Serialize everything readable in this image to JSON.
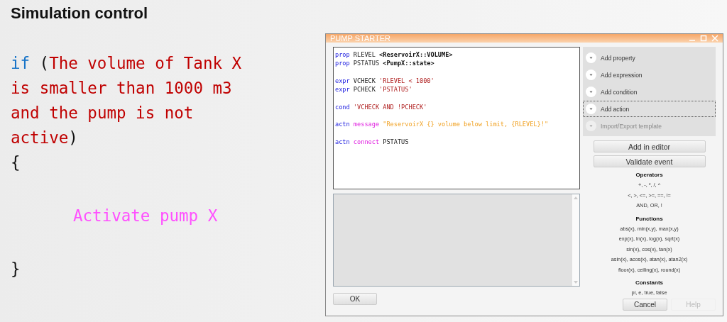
{
  "slide": {
    "title": "Simulation control",
    "code": [
      {
        "gap_before": false,
        "indent": false,
        "tokens": [
          {
            "kind": "keyword",
            "text": "if",
            "attached": true
          },
          {
            "kind": "plain",
            "text": "(",
            "attached": false
          },
          {
            "kind": "condition",
            "text": "The volume of Tank X",
            "attached": true
          }
        ]
      },
      {
        "gap_before": false,
        "indent": false,
        "tokens": [
          {
            "kind": "condition",
            "text": "is smaller than 1000 m3",
            "attached": true
          }
        ]
      },
      {
        "gap_before": false,
        "indent": false,
        "tokens": [
          {
            "kind": "condition",
            "text": "and the pump is not",
            "attached": true
          }
        ]
      },
      {
        "gap_before": false,
        "indent": false,
        "tokens": [
          {
            "kind": "condition",
            "text": "active",
            "attached": true
          },
          {
            "kind": "plain",
            "text": ")",
            "attached": true
          }
        ]
      },
      {
        "gap_before": false,
        "indent": false,
        "tokens": [
          {
            "kind": "plain",
            "text": "{",
            "attached": true
          }
        ]
      },
      {
        "gap_before": true,
        "indent": true,
        "tokens": [
          {
            "kind": "action",
            "text": "Activate pump X",
            "attached": true
          }
        ]
      },
      {
        "gap_before": true,
        "indent": false,
        "tokens": [
          {
            "kind": "plain",
            "text": "}",
            "attached": true
          }
        ]
      }
    ]
  },
  "window": {
    "title": "PUMP STARTER",
    "editor": {
      "lines": [
        {
          "gap_before": false,
          "tokens": [
            {
              "kind": "keyword",
              "text": "prop"
            },
            {
              "kind": "plain",
              "text": "RLEVEL"
            },
            {
              "kind": "type",
              "text": "<ReservoirX::VOLUME>"
            }
          ]
        },
        {
          "gap_before": false,
          "tokens": [
            {
              "kind": "keyword",
              "text": "prop"
            },
            {
              "kind": "plain",
              "text": "PSTATUS"
            },
            {
              "kind": "type",
              "text": "<PumpX::state>"
            }
          ]
        },
        {
          "gap_before": true,
          "tokens": [
            {
              "kind": "keyword",
              "text": "expr"
            },
            {
              "kind": "plain",
              "text": "VCHECK"
            },
            {
              "kind": "string",
              "text": "'RLEVEL < 1000'"
            }
          ]
        },
        {
          "gap_before": false,
          "tokens": [
            {
              "kind": "keyword",
              "text": "expr"
            },
            {
              "kind": "plain",
              "text": "PCHECK"
            },
            {
              "kind": "string",
              "text": "'PSTATUS'"
            }
          ]
        },
        {
          "gap_before": true,
          "tokens": [
            {
              "kind": "keyword",
              "text": "cond"
            },
            {
              "kind": "string",
              "text": "'VCHECK AND !PCHECK'"
            }
          ]
        },
        {
          "gap_before": true,
          "tokens": [
            {
              "kind": "keyword",
              "text": "actn"
            },
            {
              "kind": "function",
              "text": "message"
            },
            {
              "kind": "message",
              "text": "\"ReservoirX {} volume below limit, {RLEVEL}!\""
            }
          ]
        },
        {
          "gap_before": true,
          "tokens": [
            {
              "kind": "keyword",
              "text": "actn"
            },
            {
              "kind": "function",
              "text": "connect"
            },
            {
              "kind": "plain",
              "text": "PSTATUS"
            }
          ]
        }
      ]
    },
    "actions": [
      {
        "label": "Add property",
        "focused": false,
        "disabled": false
      },
      {
        "label": "Add expression",
        "focused": false,
        "disabled": false
      },
      {
        "label": "Add condition",
        "focused": false,
        "disabled": false
      },
      {
        "label": "Add action",
        "focused": true,
        "disabled": false
      },
      {
        "label": "Import/Export template",
        "focused": false,
        "disabled": true
      }
    ],
    "buttons": [
      "Add in editor",
      "Validate event"
    ],
    "reference": [
      {
        "heading": "Operators",
        "lines": [
          "+, -, *, /, ^",
          "<, >, <=, >=, ==, !=",
          "AND, OR, !"
        ]
      },
      {
        "heading": "Functions",
        "lines": [
          "abs(x), min(x,y), max(x,y)",
          "exp(x), ln(x), log(x), sqrt(x)",
          "sin(x), cos(x), tan(x)",
          "asin(x), acos(x), atan(x), atan2(x)",
          "floor(x), ceiling(x), round(x)"
        ]
      },
      {
        "heading": "Constants",
        "lines": [
          "pi, e, true, false"
        ]
      }
    ],
    "footer": {
      "ok": {
        "label": "OK",
        "disabled": false
      },
      "cancel": {
        "label": "Cancel",
        "disabled": false
      },
      "help": {
        "label": "Help",
        "disabled": true
      }
    }
  }
}
